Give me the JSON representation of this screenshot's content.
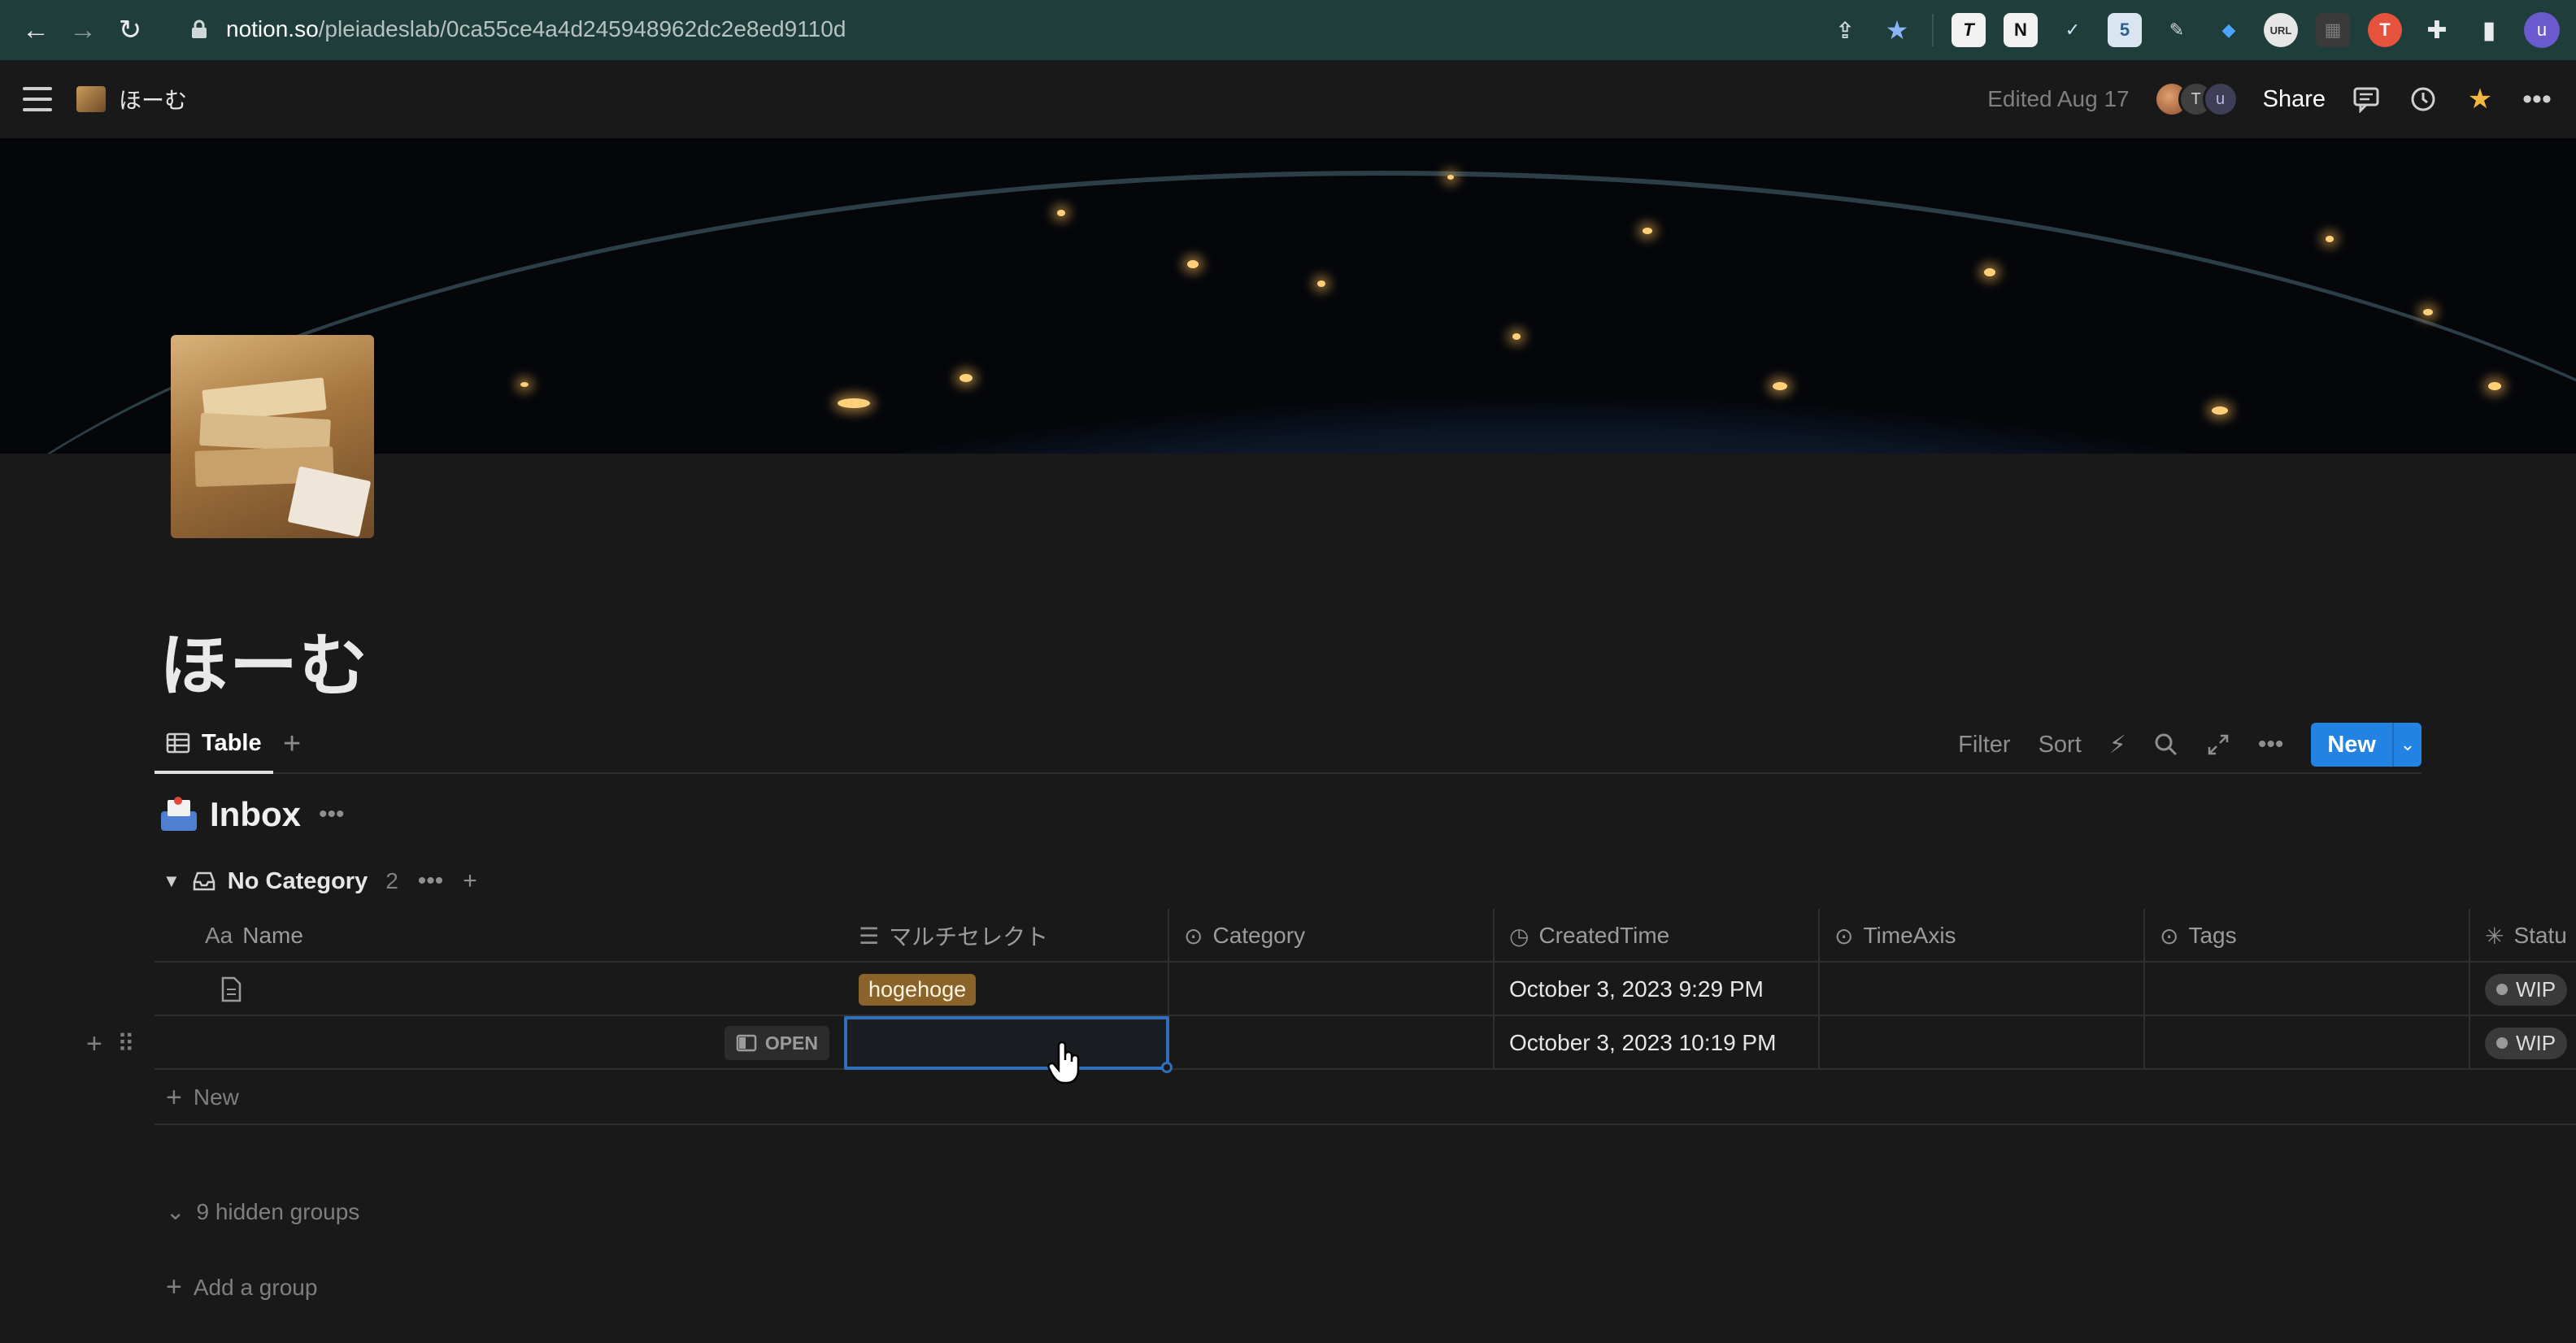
{
  "browser": {
    "url_host": "notion.so",
    "url_path": "/pleiadeslab/0ca55ce4a4d245948962dc2e8ed9110d",
    "extensions": [
      {
        "icon": "typora-icon",
        "label": "T",
        "color": "#1f1f1f"
      },
      {
        "icon": "notion-icon",
        "label": "N",
        "color": "#2b2b2b"
      },
      {
        "icon": "checkmark-icon",
        "label": "✓",
        "color": "#1f3d3a"
      },
      {
        "icon": "clipper-icon",
        "label": "5",
        "color": "#2d5f8a"
      },
      {
        "icon": "pen-icon",
        "label": "✎",
        "color": "#1f3d3a"
      },
      {
        "icon": "diamond-icon",
        "label": "◆",
        "color": "#1f3d3a"
      },
      {
        "icon": "url-icon",
        "label": "URL",
        "color": "#cccccc"
      },
      {
        "icon": "app-icon",
        "label": "▦",
        "color": "#3a3a3a"
      },
      {
        "icon": "translate-icon",
        "label": "T",
        "color": "#e5533d"
      },
      {
        "icon": "puzzle-icon",
        "label": "✚",
        "color": "#1f3d3a"
      },
      {
        "icon": "sidepanel-icon",
        "label": "▮",
        "color": "#1f3d3a"
      }
    ],
    "profile_initial": "u"
  },
  "topbar": {
    "breadcrumb_title": "ほーむ",
    "edited": "Edited Aug 17",
    "avatar_initials": [
      "T",
      "u"
    ],
    "share_label": "Share"
  },
  "page": {
    "title": "ほーむ"
  },
  "view": {
    "tab_label": "Table",
    "filter_label": "Filter",
    "sort_label": "Sort",
    "new_label": "New"
  },
  "database": {
    "title": "Inbox"
  },
  "group": {
    "name": "No Category",
    "count": "2"
  },
  "columns": {
    "name": "Name",
    "name_type": "Aa",
    "multi": "マルチセレクト",
    "category": "Category",
    "created_time": "CreatedTime",
    "time_axis": "TimeAxis",
    "tags": "Tags",
    "status": "Statu"
  },
  "rows": [
    {
      "name": "",
      "multi_tag": "hogehoge",
      "created": "October 3, 2023 9:29 PM",
      "status": "WIP"
    },
    {
      "name": "",
      "open_label": "OPEN",
      "created": "October 3, 2023 10:19 PM",
      "status": "WIP"
    }
  ],
  "footer": {
    "new_row_label": "New",
    "hidden_groups_label": "9 hidden groups",
    "add_group_label": "Add a group"
  },
  "colors": {
    "accent": "#2383e2",
    "tag_brown": "#89632a",
    "selection": "#2f6fbb"
  }
}
